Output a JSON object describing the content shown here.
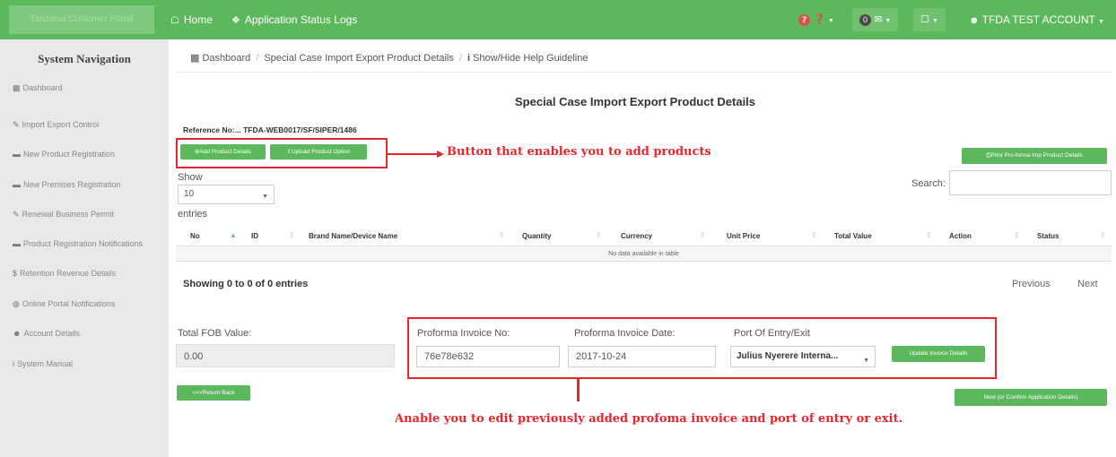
{
  "topbar": {
    "brand_text": "Tanzania Customer Portal",
    "home": "Home",
    "status_logs": "Application Status Logs",
    "notif_count": "7",
    "msg_count": "0",
    "account": "TFDA TEST ACCOUNT"
  },
  "sidebar": {
    "title": "System Navigation",
    "items": [
      {
        "icon": "dashboard-icon",
        "label": "Dashboard"
      },
      {
        "icon": "pencil-icon",
        "label": "Import Export Control"
      },
      {
        "icon": "folder-icon",
        "label": "New Product Registration"
      },
      {
        "icon": "folder-icon",
        "label": "New Premises Registration"
      },
      {
        "icon": "pencil-icon",
        "label": "Renewal Business Permit"
      },
      {
        "icon": "folder-icon",
        "label": "Product Registration Notifications"
      },
      {
        "icon": "dollar-icon",
        "label": "Retention Revenue Details"
      },
      {
        "icon": "globe-icon",
        "label": "Online Portal Notifications"
      },
      {
        "icon": "user-icon",
        "label": "Account Details"
      },
      {
        "icon": "info-icon",
        "label": "System Manual"
      }
    ]
  },
  "breadcrumb": {
    "dashboard": "Dashboard",
    "current": "Special Case Import Export Product Details",
    "help": "Show/Hide Help Guideline"
  },
  "page": {
    "title": "Special Case Import Export Product Details",
    "reference": "Reference No:... TFDA-WEB0017/SF/SIPER/1486"
  },
  "buttons": {
    "add_product": "Add Product Details",
    "upload_product": "Upload Product Option",
    "print_proforma": "Print Pro-forma Imp Product Details",
    "return_back": "<<<Return Back",
    "update_invoice": "Update Invoice Details",
    "next": "Next (or Confirm Application Details)"
  },
  "table_controls": {
    "show_label": "Show",
    "page_size": "10",
    "entries_label": "entries",
    "search_label": "Search:"
  },
  "table": {
    "columns": [
      "No",
      "ID",
      "Brand Name/Device Name",
      "Quantity",
      "Currency",
      "Unit Price",
      "Total Value",
      "Action",
      "Status"
    ],
    "empty_message": "No data available in table"
  },
  "pagination": {
    "showing": "Showing 0 to 0 of 0 entries",
    "previous": "Previous",
    "next": "Next"
  },
  "invoice_form": {
    "total_fob_label": "Total FOB Value:",
    "total_fob_value": "0.00",
    "invoice_no_label": "Proforma Invoice No:",
    "invoice_no_value": "76e78e632",
    "invoice_date_label": "Proforma Invoice Date:",
    "invoice_date_value": "2017-10-24",
    "port_label": "Port Of Entry/Exit",
    "port_value": "Julius Nyerere Interna..."
  },
  "annotations": {
    "add_products": "Button that enables you to add products",
    "edit_invoice": "Anable you to edit previously added profoma invoice and port of entry or exit."
  },
  "colors": {
    "primary_green": "#5cb85c",
    "annotation_red": "#e8262e",
    "badge_red": "#d9534f"
  }
}
